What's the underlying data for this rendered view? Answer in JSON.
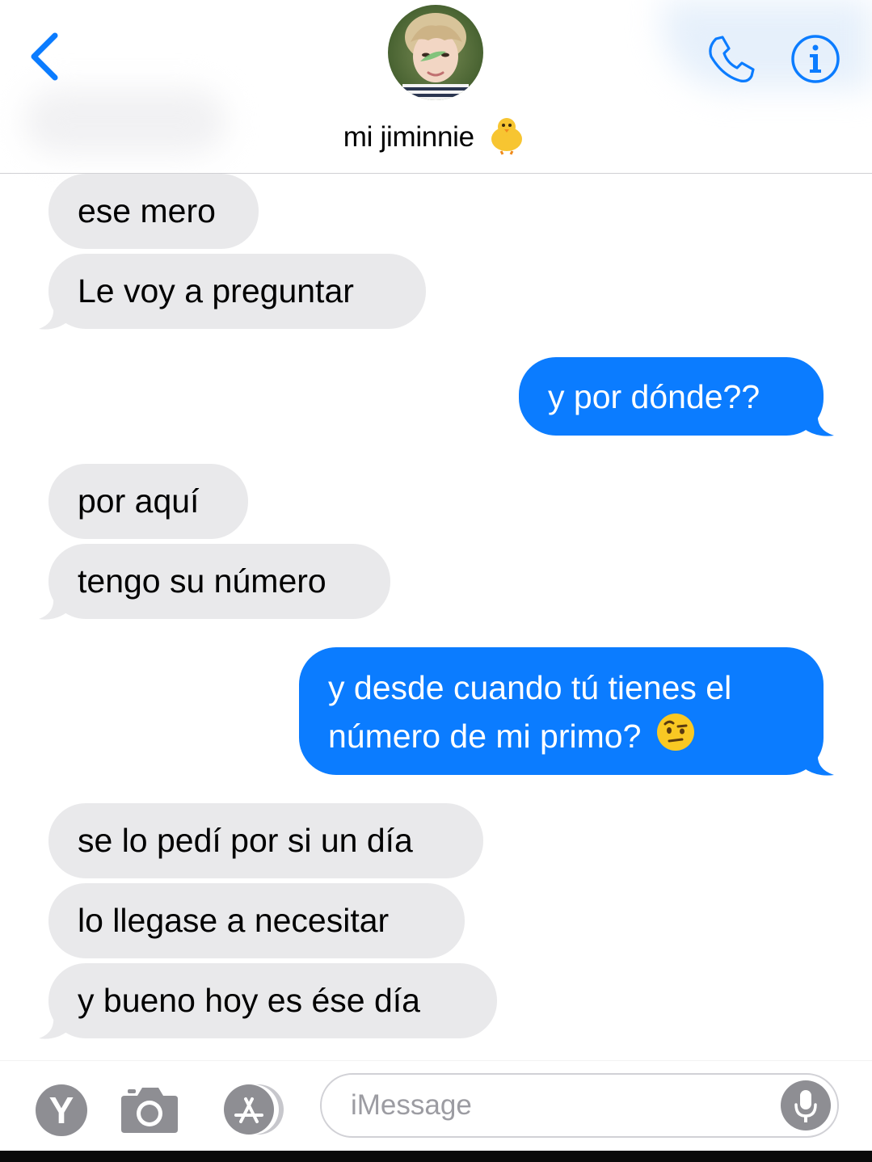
{
  "header": {
    "contact_name": "mi jiminnie",
    "contact_emoji": "chick-emoji",
    "back_icon": "chevron-left-icon",
    "call_icon": "phone-icon",
    "info_icon": "info-icon",
    "accent_color": "#0b7cff"
  },
  "messages": [
    {
      "direction": "incoming",
      "text": "ese mero"
    },
    {
      "direction": "incoming",
      "text": "Le voy a preguntar"
    },
    {
      "direction": "outgoing",
      "text": "y por dónde??"
    },
    {
      "direction": "incoming",
      "text": "por aquí"
    },
    {
      "direction": "incoming",
      "text": "tengo su número"
    },
    {
      "direction": "outgoing",
      "lines": [
        "y desde cuando tú tienes el",
        "número de mi primo?"
      ],
      "emoji": "raised-eyebrow-emoji"
    },
    {
      "direction": "incoming",
      "text": "se lo pedí por si un día"
    },
    {
      "direction": "incoming",
      "text": "lo llegase a necesitar"
    },
    {
      "direction": "incoming",
      "text": "y bueno hoy es ése día"
    }
  ],
  "composer": {
    "yahoo_app_label": "Y",
    "camera_icon": "camera-icon",
    "appstore_icon": "app-store-icon",
    "placeholder": "iMessage",
    "mic_icon": "microphone-icon"
  },
  "colors": {
    "incoming_bubble": "#e9e9eb",
    "outgoing_bubble": "#0b7cff",
    "icon_gray": "#8e8e93"
  }
}
